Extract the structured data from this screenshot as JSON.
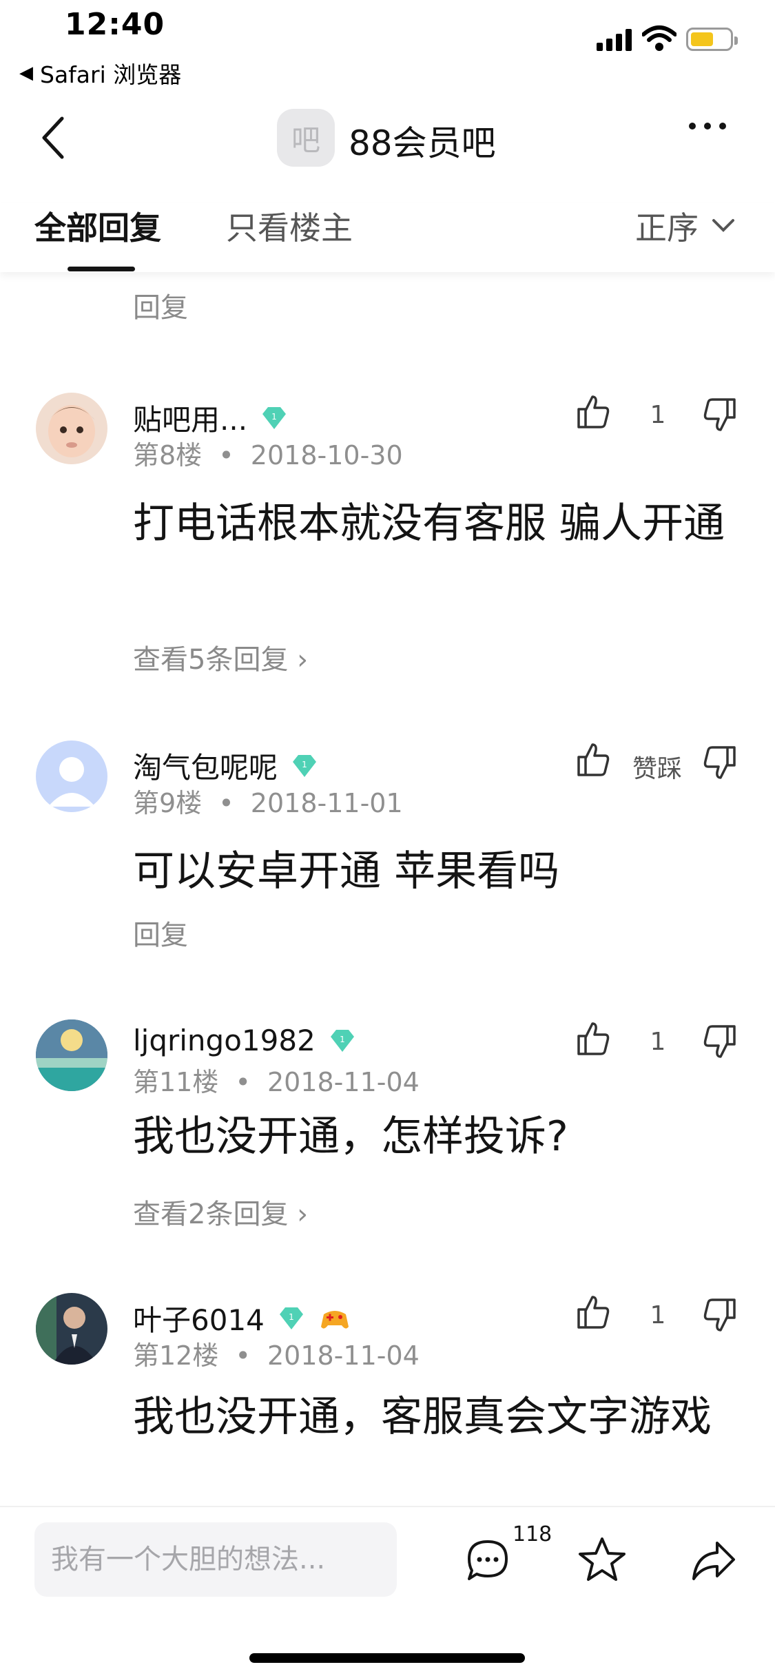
{
  "status": {
    "time": "12:40",
    "back_app": "Safari 浏览器",
    "battery_color": "#f4c51c"
  },
  "header": {
    "forum_avatar_char": "吧",
    "forum_name": "88会员吧"
  },
  "tabs": {
    "all": "全部回复",
    "owner_only": "只看楼主",
    "sort": "正序"
  },
  "top_reply_link": "回复",
  "posts": [
    {
      "username": "贴吧用...",
      "floor": "第8楼",
      "date": "2018-10-30",
      "content": "打电话根本就没有客服 骗人开通",
      "link": "查看5条回复",
      "likes": "1",
      "avatar": "baby-photo-avatar",
      "badges": [
        "gem-badge"
      ]
    },
    {
      "username": "淘气包呢呢",
      "floor": "第9楼",
      "date": "2018-11-01",
      "content": "可以安卓开通 苹果看吗",
      "link": "回复",
      "likes": "赞踩",
      "avatar": "default-avatar",
      "badges": [
        "gem-badge"
      ]
    },
    {
      "username": "ljqringo1982",
      "floor": "第11楼",
      "date": "2018-11-04",
      "content": "我也没开通，怎样投诉?",
      "link": "查看2条回复",
      "likes": "1",
      "avatar": "sunset-sea-avatar",
      "badges": [
        "gem-badge"
      ]
    },
    {
      "username": "叶子6014",
      "floor": "第12楼",
      "date": "2018-11-04",
      "content": "我也没开通，客服真会文字游戏",
      "link": "",
      "likes": "1",
      "avatar": "person-photo-avatar",
      "badges": [
        "gem-badge",
        "game-controller-badge"
      ]
    }
  ],
  "sep": "•",
  "bottom": {
    "input_placeholder": "我有一个大胆的想法...",
    "comment_count": "118"
  },
  "colors": {
    "gem": "#4fd1b5",
    "text_primary": "#141414",
    "text_secondary": "#8f8f8f"
  }
}
